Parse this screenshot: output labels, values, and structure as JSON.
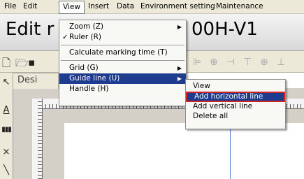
{
  "menubar": {
    "items": [
      "File",
      "Edit",
      "View",
      "Insert",
      "Data",
      "Environment setting",
      "Maintenance"
    ]
  },
  "title": {
    "left": "Edit r",
    "right": "00H-V1"
  },
  "doc_tab": {
    "label": "Desi"
  },
  "view_menu": {
    "items": [
      {
        "label": "Zoom (Z)",
        "submenu": true
      },
      {
        "label": "Ruler (R)",
        "checked": true
      },
      {
        "label": "Calculate marking time (T)"
      },
      {
        "label": "Grid (G)",
        "submenu": true
      },
      {
        "label": "Guide line (U)",
        "submenu": true,
        "selected": true
      },
      {
        "label": "Handle (H)"
      }
    ]
  },
  "guide_submenu": {
    "items": [
      {
        "label": "View"
      },
      {
        "label": "Add horizontal line",
        "highlighted": true
      },
      {
        "label": "Add vertical line"
      },
      {
        "label": "Delete all"
      }
    ]
  },
  "colors": {
    "menu_selection": "#1d3c8f",
    "highlight_border": "#d32222",
    "guide_line": "#5b7fd6"
  }
}
